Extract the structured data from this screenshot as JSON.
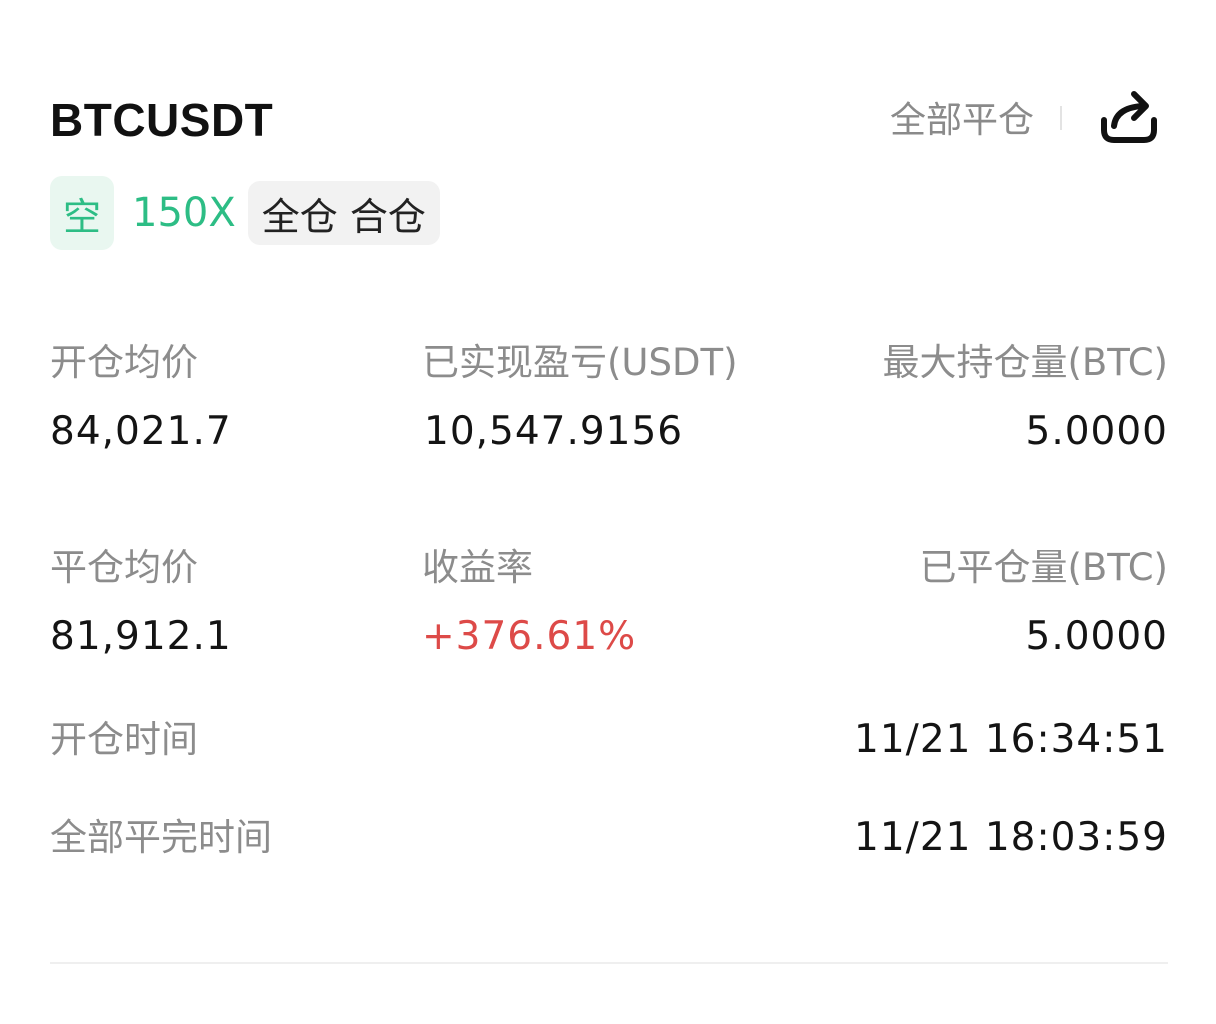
{
  "header": {
    "symbol": "BTCUSDT",
    "close_all_label": "全部平仓",
    "share_icon": "share-icon"
  },
  "tags": {
    "direction": "空",
    "leverage": "150X",
    "margin_mode": "全仓 合仓"
  },
  "stats": {
    "open_avg_price": {
      "label": "开仓均价",
      "value": "84,021.7"
    },
    "realized_pnl": {
      "label": "已实现盈亏(USDT)",
      "value": "10,547.9156"
    },
    "max_position": {
      "label": "最大持仓量(BTC)",
      "value": "5.0000"
    },
    "close_avg_price": {
      "label": "平仓均价",
      "value": "81,912.1"
    },
    "roi": {
      "label": "收益率",
      "value": "+376.61%"
    },
    "closed_position": {
      "label": "已平仓量(BTC)",
      "value": "5.0000"
    }
  },
  "times": {
    "open_time": {
      "label": "开仓时间",
      "value": "11/21 16:34:51"
    },
    "close_time": {
      "label": "全部平完时间",
      "value": "11/21 18:03:59"
    }
  },
  "colors": {
    "green": "#2dbd85",
    "red": "#dd4a48",
    "label_gray": "#8c8c8c"
  }
}
